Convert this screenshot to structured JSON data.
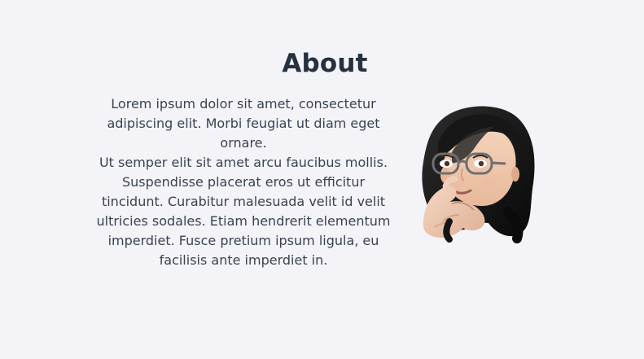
{
  "about": {
    "title": "About",
    "paragraphs": [
      "Lorem ipsum dolor sit amet, consectetur adipiscing elit. Morbi feugiat ut diam eget ornare.",
      "Ut semper elit sit amet arcu faucibus mollis. Suspendisse placerat eros ut efficitur tincidunt. Curabitur malesuada velit id velit ultricies sodales. Etiam hendrerit elementum imperdiet. Fusce pretium ipsum ligula, eu facilisis ante imperdiet in."
    ],
    "avatar": {
      "icon": "thinking-memoji-avatar"
    }
  },
  "colors": {
    "background": "#f4f4f8",
    "heading": "#253040",
    "text": "#3a4252"
  }
}
